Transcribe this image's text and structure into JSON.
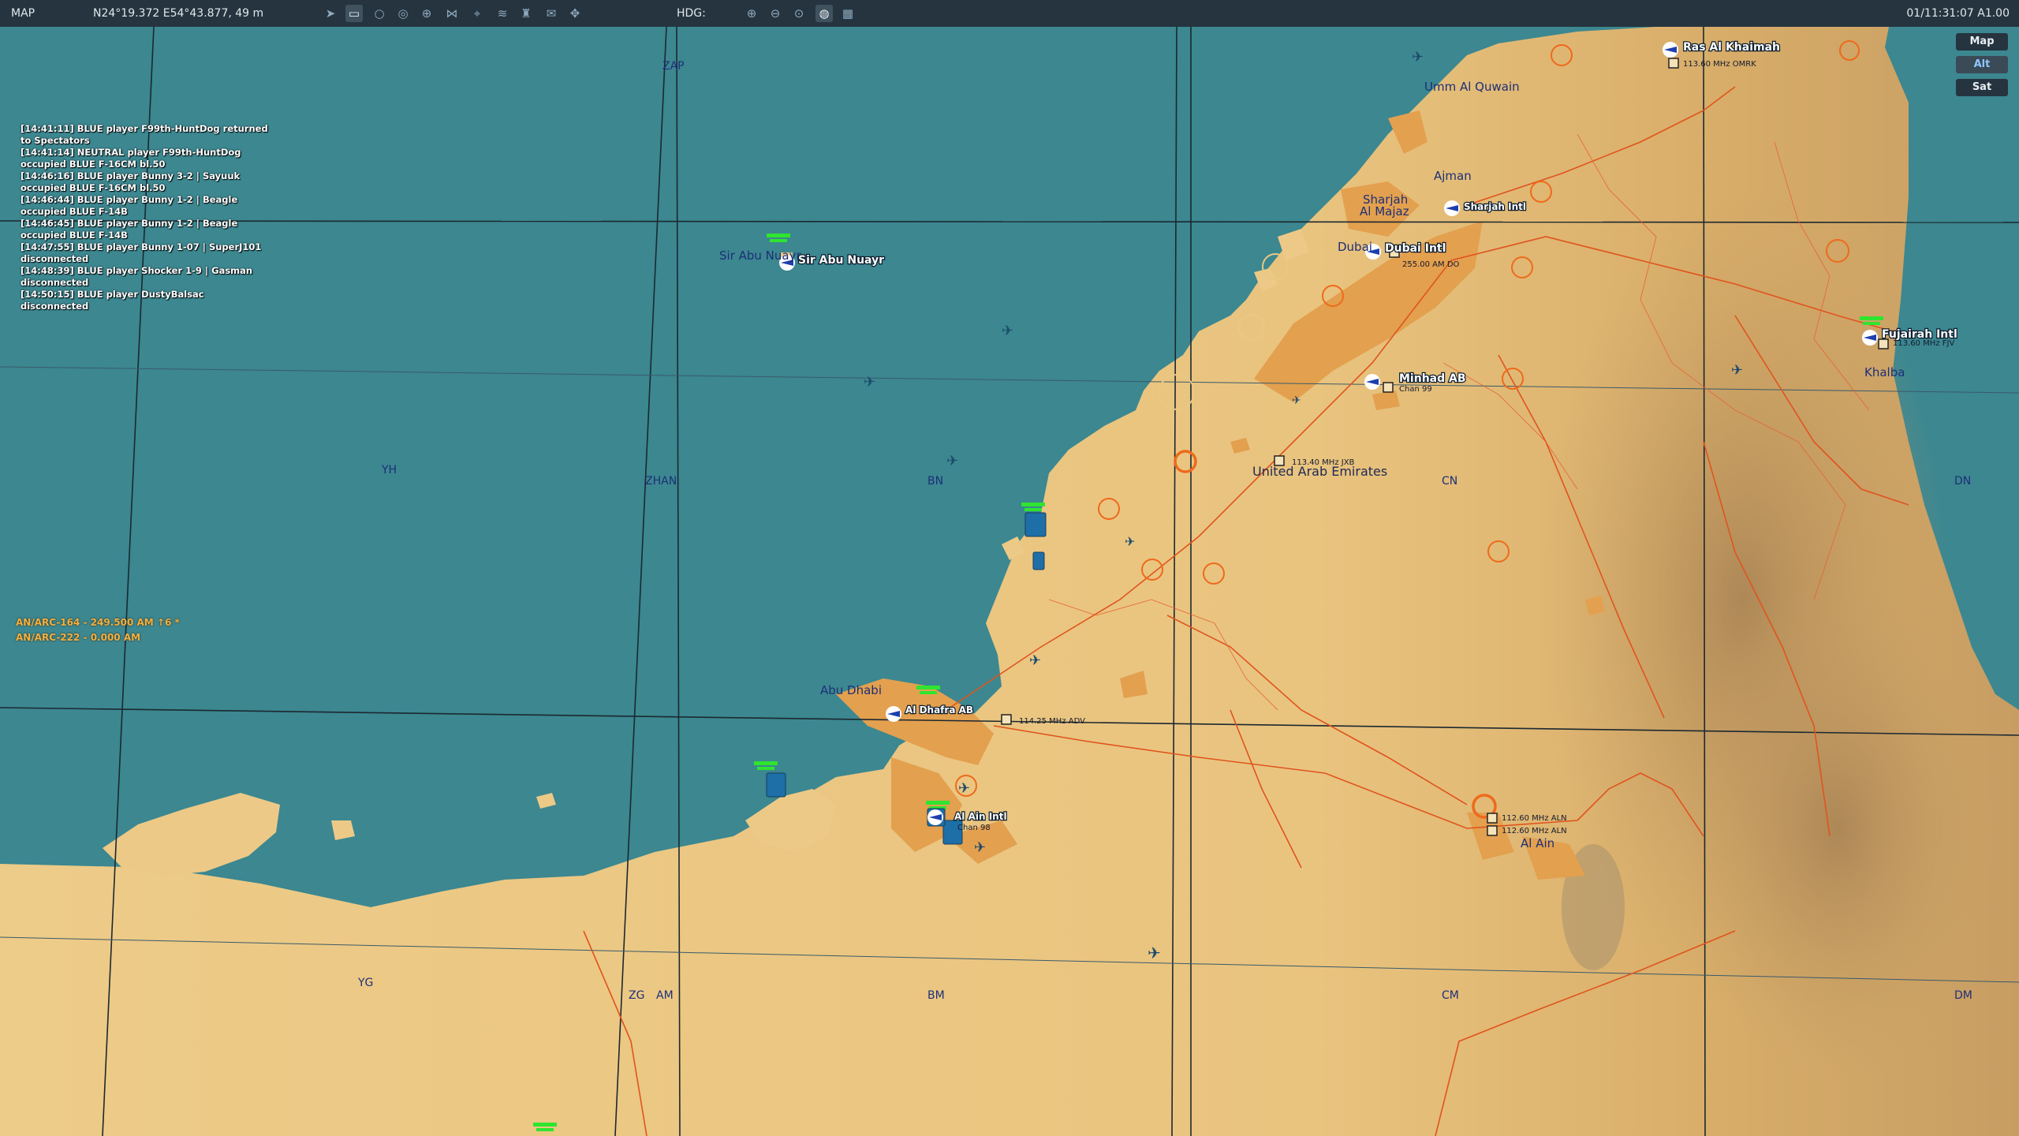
{
  "topbar": {
    "mode": "MAP",
    "coords": "N24°19.372 E54°43.877, 49 m",
    "hdg_label": "HDG:",
    "time": "01/11:31:07 A1.00",
    "tools": [
      "navigate-icon",
      "ruler-icon",
      "circle-icon",
      "layers-icon",
      "waypoint-icon",
      "route-icon",
      "target-icon",
      "radio-icon",
      "tower-icon",
      "chat-icon",
      "move-icon"
    ],
    "zoom_tools": [
      "zoom-in-icon",
      "zoom-out-icon",
      "zoom-fit-icon",
      "globe-icon",
      "grid-icon"
    ]
  },
  "layers": {
    "map": "Map",
    "alt": "Alt",
    "sat": "Sat",
    "selected": "Alt"
  },
  "log": [
    "[14:41:11] BLUE player F99th-HuntDog returned to Spectators",
    "[14:41:14] NEUTRAL player F99th-HuntDog occupied BLUE F-16CM bl.50",
    "[14:46:16] BLUE player Bunny 3-2 | Sayuuk occupied BLUE F-16CM bl.50",
    "[14:46:44] BLUE player Bunny 1-2 | Beagle occupied BLUE F-14B",
    "[14:46:45] BLUE player Bunny 1-2 | Beagle occupied BLUE F-14B",
    "[14:47:55] BLUE player Bunny 1-07 | SuperJ101 disconnected",
    "[14:48:39] BLUE player Shocker 1-9 | Gasman disconnected",
    "[14:50:15] BLUE player DustyBalsac disconnected"
  ],
  "radios": [
    "AN/ARC-164 - 249.500 AM ↑6 *",
    "AN/ARC-222 - 0.000 AM"
  ],
  "map": {
    "grid_labels": [
      "ZAP",
      "YH",
      "ZHAN",
      "BN",
      "CN",
      "DN",
      "YG",
      "ZG",
      "AM",
      "BM",
      "CM",
      "DM"
    ],
    "places": [
      "Umm Al Quwain",
      "Ajman",
      "Sharjah",
      "Al Majaz",
      "Dubai",
      "Khalba",
      "United Arab Emirates",
      "Abu Dhabi",
      "Al Ain",
      "Sir Abu Nuayr"
    ],
    "airfields": [
      "Ras Al Khaimah",
      "Sharjah Intl",
      "Dubai Intl",
      "Fujairah Intl",
      "Minhad AB",
      "Sir Abu Nuayr",
      "Al Dhafra AB",
      "Al Ain Intl"
    ],
    "beacons": [
      "113.60 MHz OMRK",
      "255.00 AM DO",
      "113.60 MHz FJV",
      "Chan 99",
      "113.40 MHz JXB",
      "114.25 MHz ADV",
      "112.60 MHz ALN",
      "112.60 MHz ALN",
      "Chan 98"
    ],
    "colors": {
      "sea": "#3c8790",
      "land": "#ecc987",
      "urban": "#e39f4e",
      "roads": "#e0541e",
      "grid": "#1f2b33",
      "ident": "#1d2f77",
      "units": "#33ee33"
    }
  }
}
